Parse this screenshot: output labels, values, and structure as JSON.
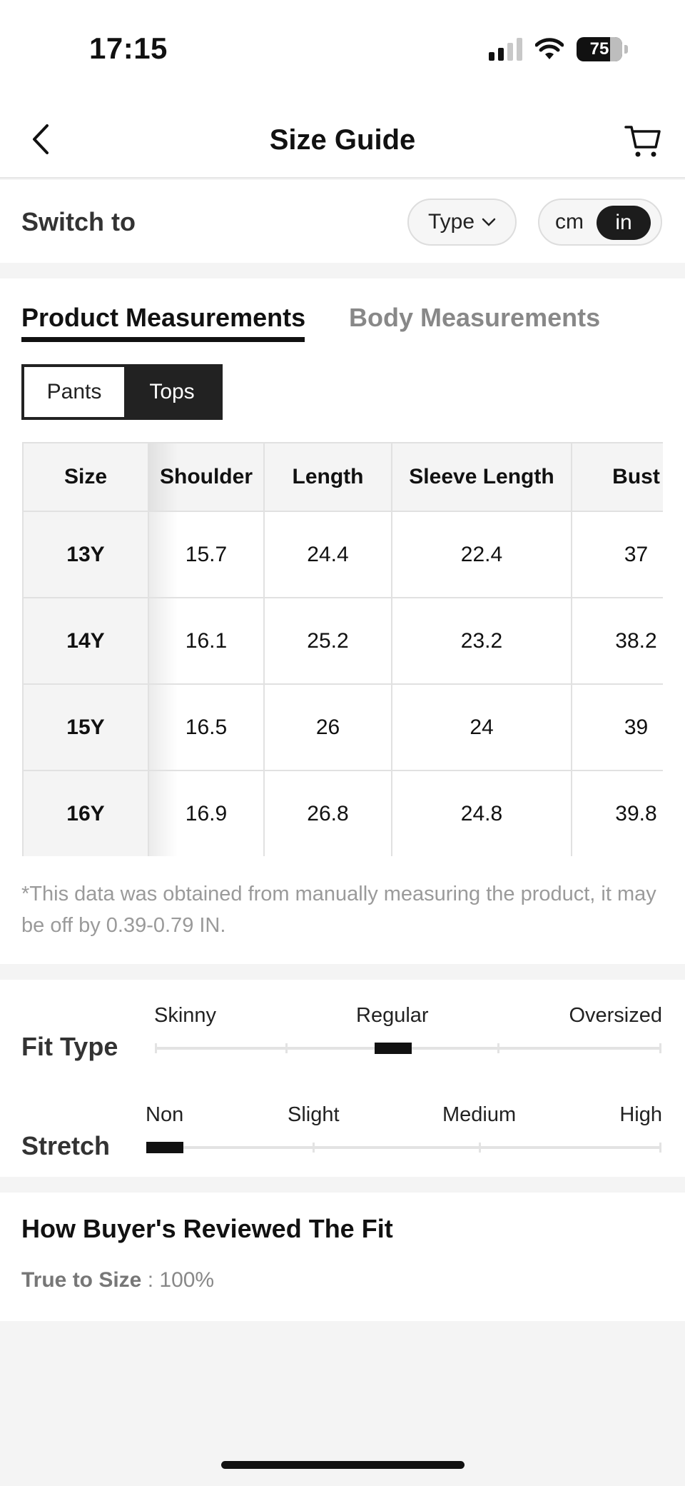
{
  "status": {
    "time": "17:15",
    "battery": "75"
  },
  "header": {
    "title": "Size Guide"
  },
  "switcher": {
    "label": "Switch to",
    "type_label": "Type",
    "unit_cm": "cm",
    "unit_in": "in"
  },
  "tabs": {
    "product": "Product Measurements",
    "body": "Body Measurements"
  },
  "segments": {
    "pants": "Pants",
    "tops": "Tops"
  },
  "table": {
    "headers": [
      "Size",
      "Shoulder",
      "Length",
      "Sleeve Length",
      "Bust"
    ],
    "rows": [
      [
        "13Y",
        "15.7",
        "24.4",
        "22.4",
        "37"
      ],
      [
        "14Y",
        "16.1",
        "25.2",
        "23.2",
        "38.2"
      ],
      [
        "15Y",
        "16.5",
        "26",
        "24",
        "39"
      ],
      [
        "16Y",
        "16.9",
        "26.8",
        "24.8",
        "39.8"
      ]
    ]
  },
  "disclaimer": "*This data was obtained from manually measuring the product, it may be off by 0.39-0.79 IN.",
  "fit": {
    "fit_type": {
      "label": "Fit Type",
      "scale": [
        "Skinny",
        "Regular",
        "Oversized"
      ],
      "value": "Regular"
    },
    "stretch": {
      "label": "Stretch",
      "scale": [
        "Non",
        "Slight",
        "Medium",
        "High"
      ],
      "value": "Non"
    }
  },
  "review": {
    "title": "How Buyer's Reviewed The Fit",
    "metric_label": "True to Size",
    "metric_value": " : 100%"
  },
  "colors": {
    "accent": "#111111",
    "muted": "#888888",
    "background": "#f4f4f4"
  }
}
